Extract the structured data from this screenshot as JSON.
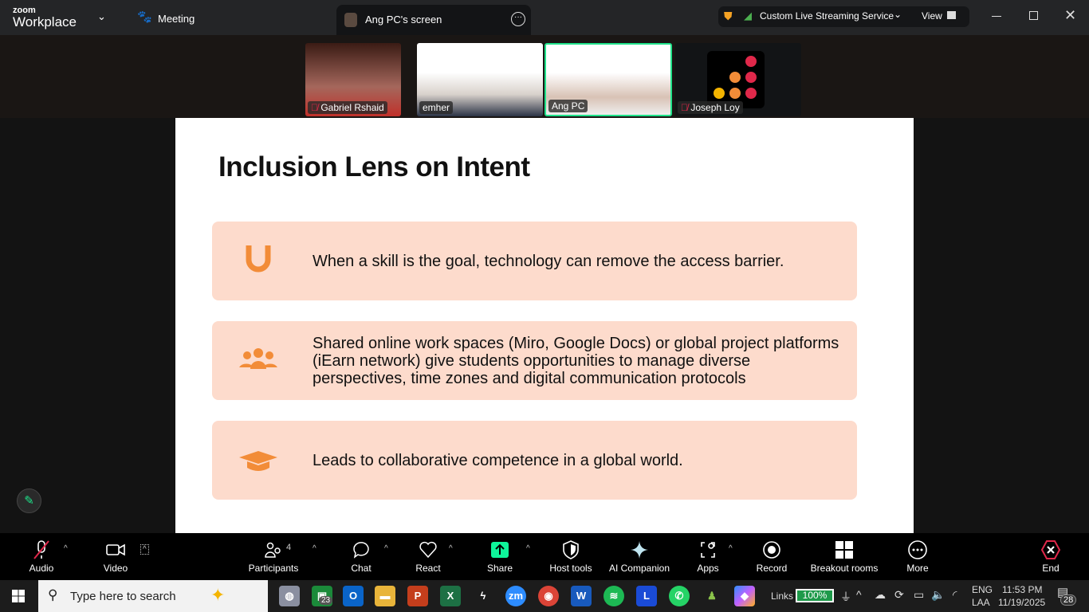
{
  "topbar": {
    "brand_small": "zoom",
    "brand": "Workplace",
    "meeting": "Meeting",
    "share_tab": "Ang PC's screen",
    "streaming": "Custom Live Streaming Service",
    "view": "View"
  },
  "participants": [
    {
      "name": "Gabriel Rshaid",
      "muted": true
    },
    {
      "name": "emher",
      "muted": false
    },
    {
      "name": "Ang PC",
      "muted": false,
      "active_speaker": true
    },
    {
      "name": "Joseph Loy",
      "muted": true
    }
  ],
  "slide": {
    "title": "Inclusion Lens on Intent",
    "cards": [
      {
        "icon": "horseshoe-icon",
        "text": "When a skill is the goal, technology can remove the access barrier."
      },
      {
        "icon": "people-group-icon",
        "text": "Shared online work spaces (Miro, Google Docs) or global project platforms (iEarn network) give students opportunities to manage diverse perspectives, time zones and digital communication protocols"
      },
      {
        "icon": "graduation-cap-icon",
        "text": "Leads to collaborative competence in a global world."
      }
    ]
  },
  "toolbar": {
    "audio": "Audio",
    "video": "Video",
    "participants": "Participants",
    "participant_count": "4",
    "chat": "Chat",
    "react": "React",
    "share": "Share",
    "host_tools": "Host tools",
    "ai_companion": "AI Companion",
    "apps": "Apps",
    "record": "Record",
    "breakout": "Breakout rooms",
    "more": "More",
    "end": "End"
  },
  "taskbar": {
    "search_placeholder": "Type here to search",
    "badge_count": "23",
    "links": "Links",
    "battery": "100%",
    "lang1": "ENG",
    "lang2": "LAA",
    "time": "11:53 PM",
    "date": "11/19/2025",
    "notifications": "28"
  },
  "colors": {
    "card": "#fddbcc",
    "accent": "#f28c38",
    "share_green": "#0ef59a",
    "end_red": "#e0284a"
  }
}
